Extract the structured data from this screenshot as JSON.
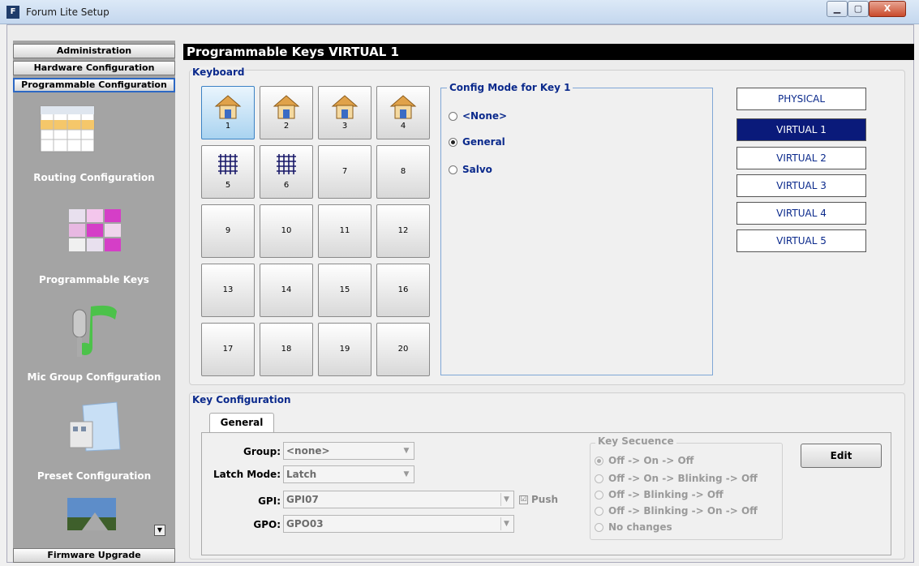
{
  "window": {
    "title": "Forum Lite Setup",
    "app_icon": "F",
    "min": "▁",
    "max": "▢",
    "close": "X"
  },
  "nav": {
    "administration": "Administration",
    "hardware": "Hardware Configuration",
    "programmable": "Programmable Configuration",
    "firmware": "Firmware Upgrade"
  },
  "sidebar": {
    "items": [
      {
        "label": "Routing Configuration",
        "icon": "grid-sheet-icon"
      },
      {
        "label": "Programmable Keys",
        "icon": "pink-blocks-icon"
      },
      {
        "label": "Mic Group Configuration",
        "icon": "mic-music-icon"
      },
      {
        "label": "Preset Configuration",
        "icon": "folder-icon"
      }
    ],
    "scroll_glyph": "▼"
  },
  "header": {
    "title": "Programmable Keys VIRTUAL  1"
  },
  "keyboard": {
    "title": "Keyboard",
    "keys": [
      "1",
      "2",
      "3",
      "4",
      "5",
      "6",
      "7",
      "8",
      "9",
      "10",
      "11",
      "12",
      "13",
      "14",
      "15",
      "16",
      "17",
      "18",
      "19",
      "20"
    ]
  },
  "config_mode": {
    "title": "Config Mode for Key 1",
    "options": [
      "<None>",
      "General",
      "Salvo"
    ],
    "selected": "General"
  },
  "virtual_buttons": [
    "PHYSICAL",
    "VIRTUAL 1",
    "VIRTUAL 2",
    "VIRTUAL 3",
    "VIRTUAL 4",
    "VIRTUAL 5"
  ],
  "key_config": {
    "title": "Key Configuration",
    "tab": "General",
    "group_label": "Group:",
    "group_value": "<none>",
    "latch_label": "Latch Mode:",
    "latch_value": "Latch",
    "gpi_label": "GPI:",
    "gpi_value": "GPI07",
    "gpo_label": "GPO:",
    "gpo_value": "GPO03",
    "push_label": "Push",
    "push_checked": "☑",
    "sequence_title": "Key Secuence",
    "sequence": [
      "Off -> On -> Off",
      "Off -> On -> Blinking -> Off",
      "Off -> Blinking -> Off",
      "Off -> Blinking -> On -> Off",
      "No changes"
    ],
    "edit": "Edit"
  }
}
